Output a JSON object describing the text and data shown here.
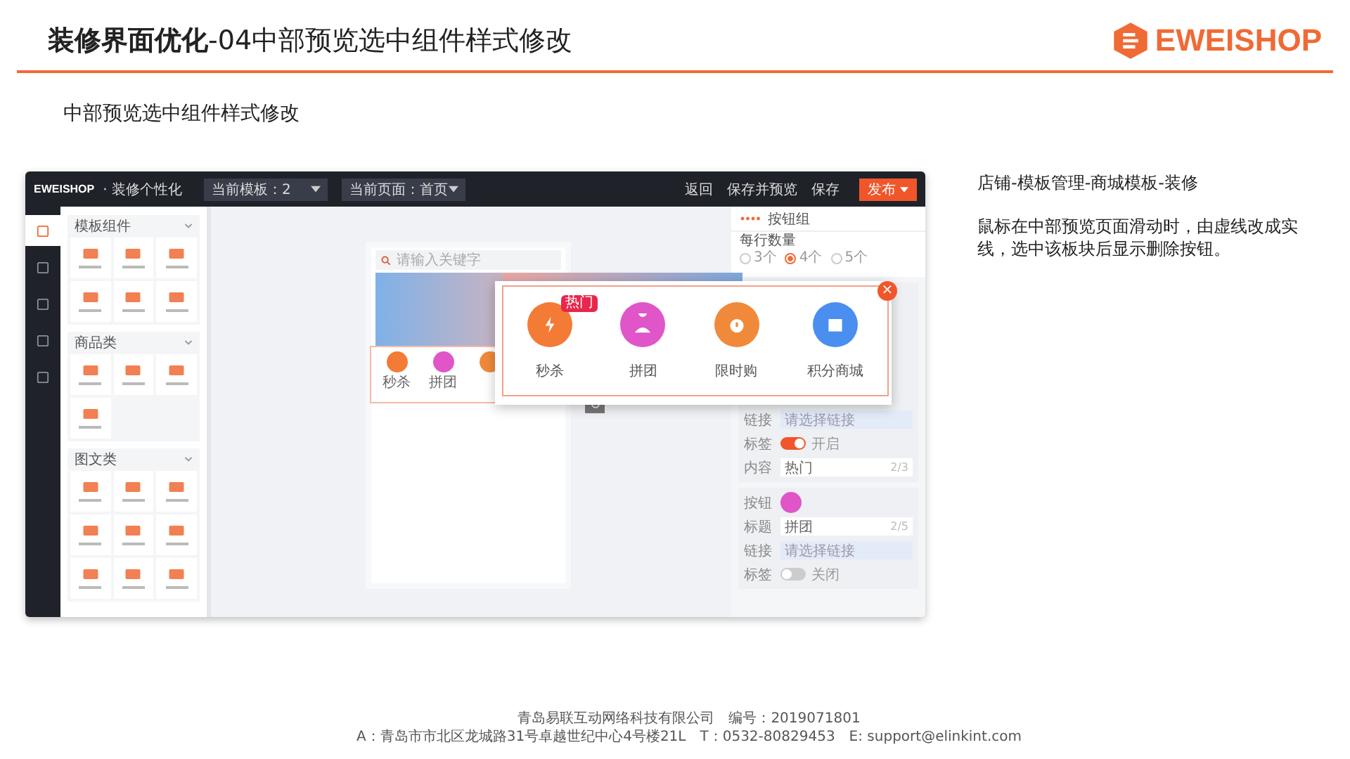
{
  "header": {
    "title": "**装修界面优化**-04中部预览选中组件样式修改",
    "logo": "EWEISHOP"
  },
  "subtitle": "中部预览选中组件样式修改",
  "app": {
    "topbar": {
      "logo": "EWEISHOP",
      "app_title": "· 装修个性化",
      "dropdowns": [
        {
          "label": "当前模板：2"
        },
        {
          "label": "当前页面：首页"
        }
      ],
      "actions": [
        "返回",
        "保存并预览",
        "保存"
      ],
      "publish": "发布"
    },
    "nav": [
      {
        "selected": true
      },
      {
        "selected": false
      },
      {
        "selected": false
      },
      {
        "selected": false
      },
      {
        "selected": false
      }
    ],
    "groups": [
      {
        "title": "模板组件",
        "expanded": true
      },
      {
        "title": "商品类",
        "expanded": true
      },
      {
        "title": "图文类",
        "expanded": true
      }
    ],
    "phone": {
      "search_placeholder": "请输入关键字",
      "buttons": [
        {
          "label": "秒杀",
          "color": "#f37b35"
        },
        {
          "label": "拼团",
          "color": "#e055c8"
        }
      ]
    },
    "popup": {
      "close": "×",
      "items": [
        {
          "label": "秒杀",
          "badge": "热门",
          "color": "#f37b35"
        },
        {
          "label": "拼团",
          "color": "#e055c8"
        },
        {
          "label": "限时购",
          "color": "#f08a3a"
        },
        {
          "label": "积分商城",
          "color": "#4a8ef0"
        }
      ]
    },
    "settings": {
      "title": "按钮组",
      "per_row_label": "每行数量",
      "options": [
        {
          "label": "3个",
          "selected": false
        },
        {
          "label": "4个",
          "selected": true
        },
        {
          "label": "5个",
          "selected": false
        }
      ],
      "cards": [
        {
          "rows": [
            {
              "kind": "link",
              "label": "链接",
              "placeholder": "请选择链接"
            },
            {
              "kind": "toggle",
              "label": "标签",
              "on": true,
              "state": "开启"
            },
            {
              "kind": "text",
              "label": "内容",
              "value": "热门",
              "counter": "2/3"
            }
          ]
        },
        {
          "rows": [
            {
              "kind": "button",
              "label": "按钮",
              "color": "#e055c8"
            },
            {
              "kind": "text",
              "label": "标题",
              "value": "拼团",
              "counter": "2/5"
            },
            {
              "kind": "link",
              "label": "链接",
              "placeholder": "请选择链接"
            },
            {
              "kind": "toggle",
              "label": "标签",
              "on": false,
              "state": "关闭"
            }
          ]
        }
      ]
    }
  },
  "notes": {
    "path": "店铺-模板管理-商城模板-装修",
    "description": "鼠标在中部预览页面滑动时，由虚线改成实线，选中该板块后显示删除按钮。"
  },
  "footer": [
    "青岛易联互动网络科技有限公司　编号：2019071801",
    "A：青岛市市北区龙城路31号卓越世纪中心4号楼21L　T：0532-80829453　E: support@elinkint.com"
  ]
}
